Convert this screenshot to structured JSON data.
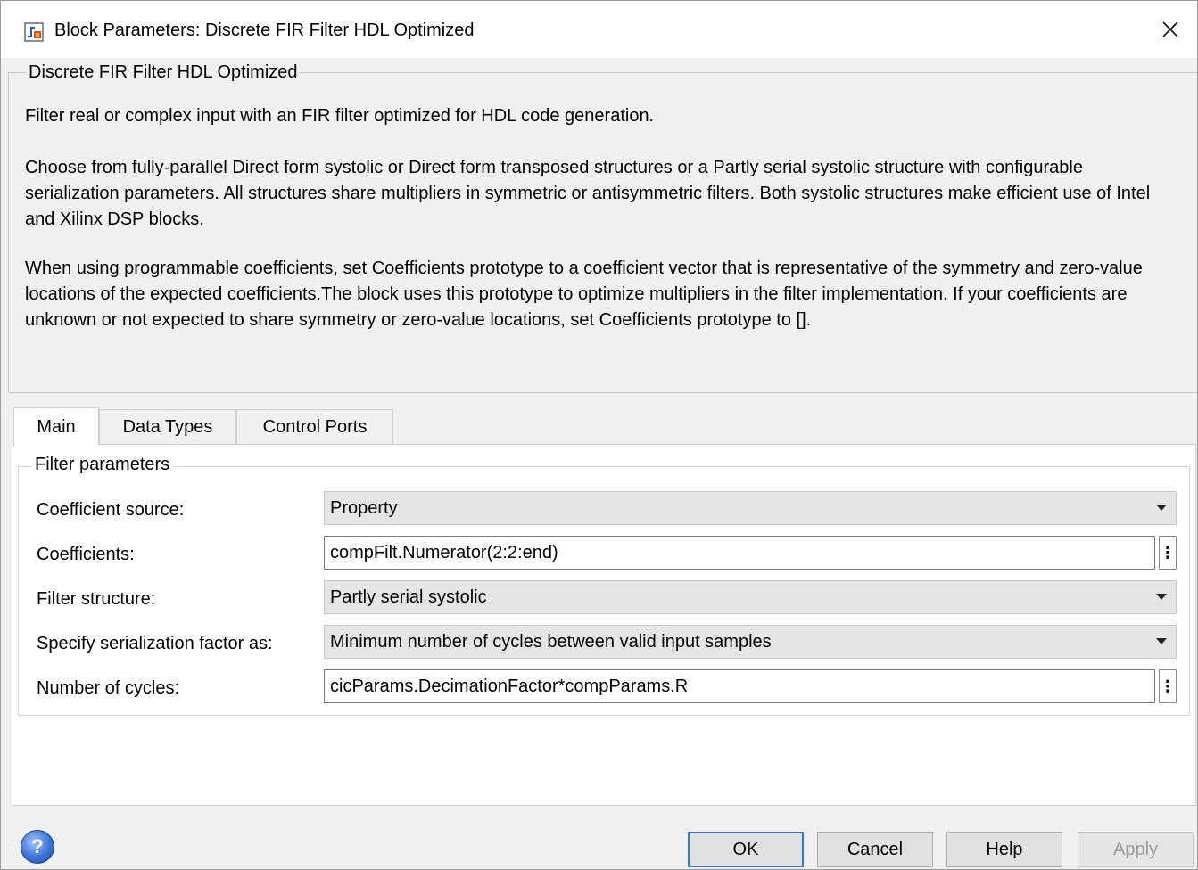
{
  "window": {
    "title": "Block Parameters: Discrete FIR Filter HDL Optimized"
  },
  "description": {
    "legend": "Discrete FIR Filter HDL Optimized",
    "paragraphs": [
      "Filter real or complex input with an FIR filter optimized for HDL code generation.",
      "Choose from fully-parallel Direct form systolic or Direct form transposed structures or a Partly serial systolic structure with configurable serialization parameters. All structures share multipliers in symmetric or antisymmetric filters. Both systolic structures make efficient use of Intel and Xilinx DSP blocks.",
      "When using programmable coefficients, set Coefficients prototype to a coefficient vector that is representative of the symmetry and zero-value locations of the expected coefficients.The block uses this prototype to optimize multipliers in the filter implementation. If your coefficients are unknown or not expected to share symmetry or zero-value locations, set Coefficients prototype to []."
    ]
  },
  "tabs": [
    {
      "label": "Main",
      "active": true
    },
    {
      "label": "Data Types",
      "active": false
    },
    {
      "label": "Control Ports",
      "active": false
    }
  ],
  "filter_params": {
    "legend": "Filter parameters",
    "coefficient_source": {
      "label": "Coefficient source:",
      "value": "Property"
    },
    "coefficients": {
      "label": "Coefficients:",
      "value": "compFilt.Numerator(2:2:end)"
    },
    "filter_structure": {
      "label": "Filter structure:",
      "value": "Partly serial systolic"
    },
    "serialization": {
      "label": "Specify serialization factor as:",
      "value": "Minimum number of cycles between valid input samples"
    },
    "num_cycles": {
      "label": "Number of cycles:",
      "value": "cicParams.DecimationFactor*compParams.R"
    }
  },
  "buttons": {
    "ok": "OK",
    "cancel": "Cancel",
    "help": "Help",
    "apply": "Apply"
  },
  "icons": {
    "app": "simulink-block-icon",
    "close": "close-icon",
    "help": "help-question-icon",
    "more": "vertical-ellipsis-icon"
  },
  "colors": {
    "default_button_border": "#2b78d8",
    "panel_bg": "#f0f0f0",
    "tab_active_bg": "#ffffff"
  }
}
